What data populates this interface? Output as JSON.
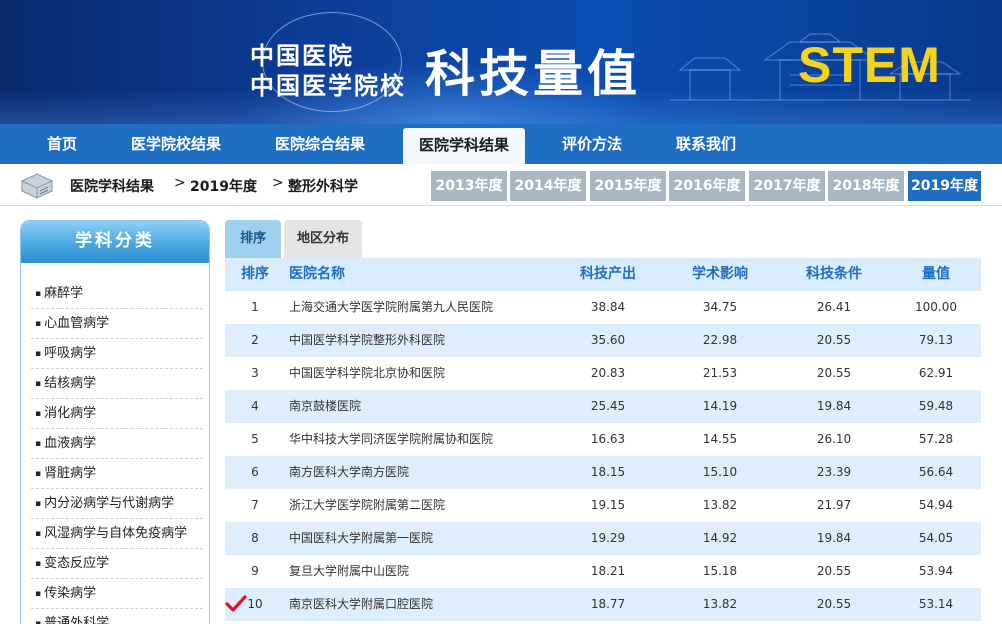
{
  "banner": {
    "logo_line1": "中国医院",
    "logo_line2": "中国医学院校",
    "title": "科技量值",
    "badge": "STEM"
  },
  "nav": {
    "items": [
      {
        "label": "首页"
      },
      {
        "label": "医学院校结果"
      },
      {
        "label": "医院综合结果"
      },
      {
        "label": "医院学科结果",
        "active": true
      },
      {
        "label": "评价方法"
      },
      {
        "label": "联系我们"
      }
    ]
  },
  "breadcrumb": {
    "level1": "医院学科结果",
    "level2": "2019年度",
    "level3": "整形外科学",
    "separator": ">"
  },
  "years": [
    "2013年度",
    "2014年度",
    "2015年度",
    "2016年度",
    "2017年度",
    "2018年度",
    "2019年度"
  ],
  "active_year": "2019年度",
  "sidebar": {
    "title": "学科分类",
    "items": [
      "麻醉学",
      "心血管病学",
      "呼吸病学",
      "结核病学",
      "消化病学",
      "血液病学",
      "肾脏病学",
      "内分泌病学与代谢病学",
      "风湿病学与自体免疫病学",
      "变态反应学",
      "传染病学",
      "普通外科学"
    ]
  },
  "tabs": {
    "rank": "排序",
    "region": "地区分布"
  },
  "table": {
    "headers": {
      "rank": "排序",
      "name": "医院名称",
      "output": "科技产出",
      "impact": "学术影响",
      "condition": "科技条件",
      "value": "量值"
    },
    "rows": [
      {
        "rank": "1",
        "name": "上海交通大学医学院附属第九人民医院",
        "output": "38.84",
        "impact": "34.75",
        "condition": "26.41",
        "value": "100.00"
      },
      {
        "rank": "2",
        "name": "中国医学科学院整形外科医院",
        "output": "35.60",
        "impact": "22.98",
        "condition": "20.55",
        "value": "79.13"
      },
      {
        "rank": "3",
        "name": "中国医学科学院北京协和医院",
        "output": "20.83",
        "impact": "21.53",
        "condition": "20.55",
        "value": "62.91"
      },
      {
        "rank": "4",
        "name": "南京鼓楼医院",
        "output": "25.45",
        "impact": "14.19",
        "condition": "19.84",
        "value": "59.48"
      },
      {
        "rank": "5",
        "name": "华中科技大学同济医学院附属协和医院",
        "output": "16.63",
        "impact": "14.55",
        "condition": "26.10",
        "value": "57.28"
      },
      {
        "rank": "6",
        "name": "南方医科大学南方医院",
        "output": "18.15",
        "impact": "15.10",
        "condition": "23.39",
        "value": "56.64"
      },
      {
        "rank": "7",
        "name": "浙江大学医学院附属第二医院",
        "output": "19.15",
        "impact": "13.82",
        "condition": "21.97",
        "value": "54.94"
      },
      {
        "rank": "8",
        "name": "中国医科大学附属第一医院",
        "output": "19.29",
        "impact": "14.92",
        "condition": "19.84",
        "value": "54.05"
      },
      {
        "rank": "9",
        "name": "复旦大学附属中山医院",
        "output": "18.21",
        "impact": "15.18",
        "condition": "20.55",
        "value": "53.94"
      },
      {
        "rank": "10",
        "name": "南京医科大学附属口腔医院",
        "output": "18.77",
        "impact": "13.82",
        "condition": "20.55",
        "value": "53.14",
        "checked": true
      }
    ]
  },
  "colors": {
    "nav_blue": "#1f6ec4",
    "badge_yellow": "#f5d21b",
    "row_alt": "#deeefc",
    "header_text": "#1f6ec4",
    "check_red": "#e0141e"
  },
  "icons": {
    "breadcrumb": "server-box-icon",
    "row_marker": "red-checkmark-icon"
  }
}
